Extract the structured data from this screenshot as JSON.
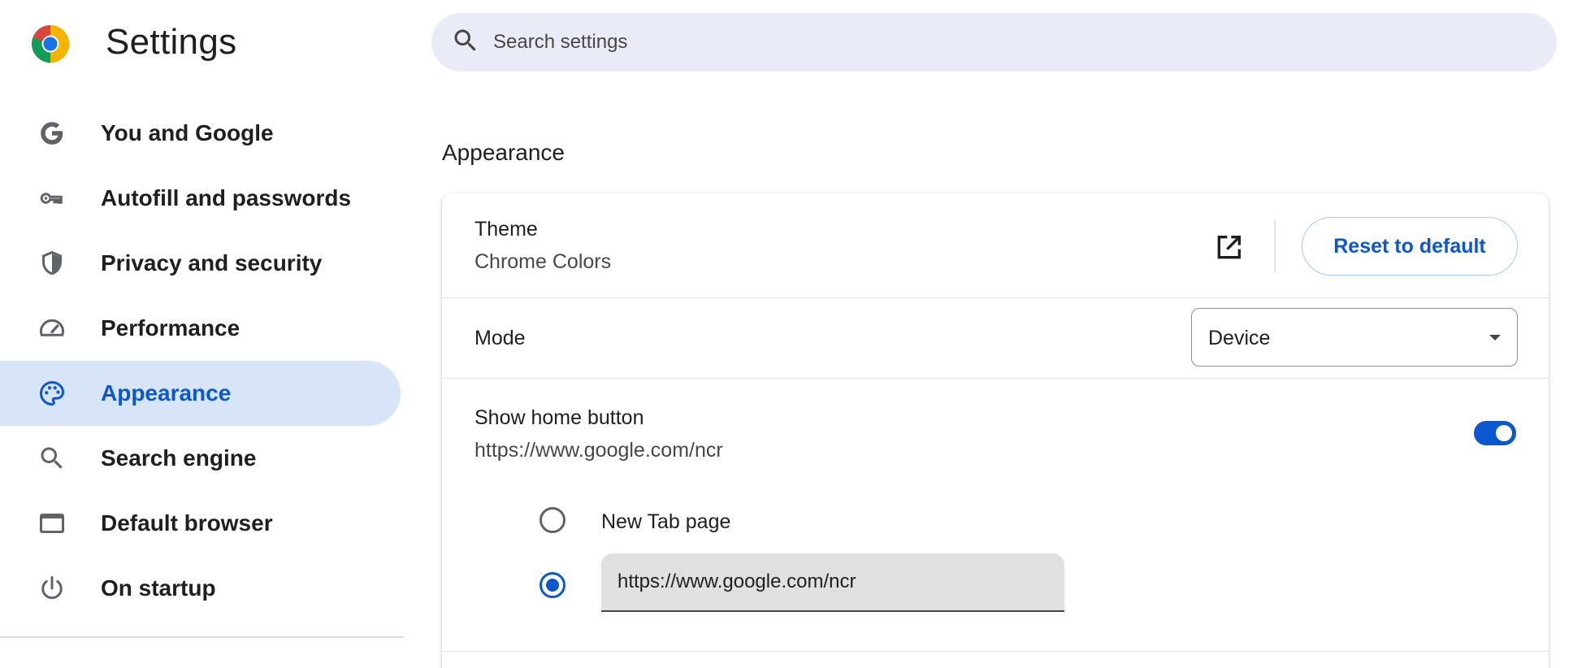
{
  "header": {
    "title": "Settings",
    "logo_icon": "chrome-logo-icon"
  },
  "search": {
    "placeholder": "Search settings",
    "icon": "search-icon"
  },
  "sidebar": {
    "items": [
      {
        "label": "You and Google",
        "icon": "google-g-icon",
        "active": false
      },
      {
        "label": "Autofill and passwords",
        "icon": "key-icon",
        "active": false
      },
      {
        "label": "Privacy and security",
        "icon": "shield-icon",
        "active": false
      },
      {
        "label": "Performance",
        "icon": "speedometer-icon",
        "active": false
      },
      {
        "label": "Appearance",
        "icon": "palette-icon",
        "active": true
      },
      {
        "label": "Search engine",
        "icon": "search-icon",
        "active": false
      },
      {
        "label": "Default browser",
        "icon": "browser-window-icon",
        "active": false
      },
      {
        "label": "On startup",
        "icon": "power-icon",
        "active": false
      }
    ]
  },
  "main": {
    "section_title": "Appearance",
    "theme": {
      "title": "Theme",
      "value": "Chrome Colors",
      "external_link_icon": "open-in-new-icon",
      "reset_label": "Reset to default"
    },
    "mode": {
      "label": "Mode",
      "selected": "Device"
    },
    "home_button": {
      "title": "Show home button",
      "url": "https://www.google.com/ncr",
      "enabled": true,
      "options": {
        "new_tab_label": "New Tab page",
        "custom_url_value": "https://www.google.com/ncr",
        "selected": "custom"
      }
    }
  },
  "colors": {
    "accent": "#0b57d0",
    "active_nav_bg": "#d8e5f8",
    "search_bg": "#e9ecf6"
  }
}
